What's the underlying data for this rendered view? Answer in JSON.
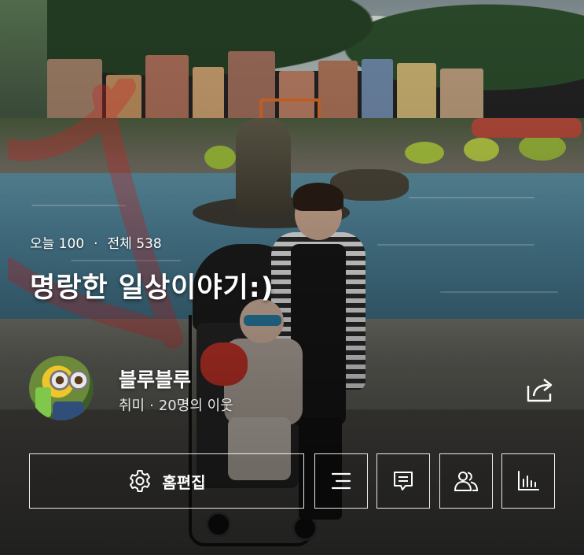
{
  "stats": {
    "today_label": "오늘 100",
    "separator": "·",
    "total_label": "전체 538"
  },
  "blog": {
    "title": "명랑한 일상이야기:)"
  },
  "profile": {
    "nickname": "블루블루",
    "category": "취미",
    "separator": "·",
    "neighbors": "20명의 이웃"
  },
  "actions": {
    "edit_home_label": "홈편집",
    "icons": [
      "gear-icon",
      "list-icon",
      "comment-icon",
      "people-icon",
      "bar-chart-icon",
      "share-icon"
    ]
  },
  "colors": {
    "text": "#ffffff",
    "button_border": "#ffffff"
  }
}
